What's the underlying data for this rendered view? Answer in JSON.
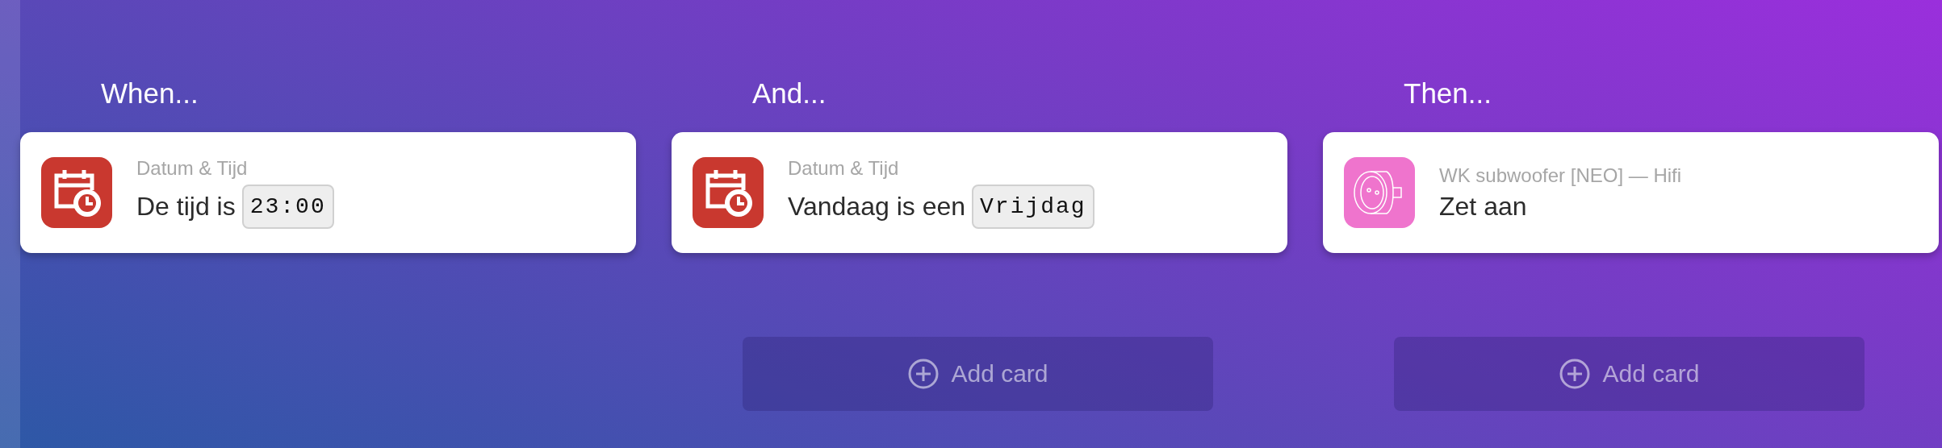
{
  "columns": [
    {
      "heading": "When...",
      "cards": [
        {
          "kind": "calendar",
          "source": "Datum & Tijd",
          "text": "De tijd is",
          "value": "23:00"
        }
      ]
    },
    {
      "heading": "And...",
      "cards": [
        {
          "kind": "calendar",
          "source": "Datum & Tijd",
          "text": "Vandaag is een",
          "value": "Vrijdag"
        }
      ],
      "add_button": "Add card"
    },
    {
      "heading": "Then...",
      "cards": [
        {
          "kind": "socket",
          "source": "WK subwoofer [NEO] — Hifi",
          "text": "Zet aan"
        }
      ],
      "add_button": "Add card"
    }
  ]
}
